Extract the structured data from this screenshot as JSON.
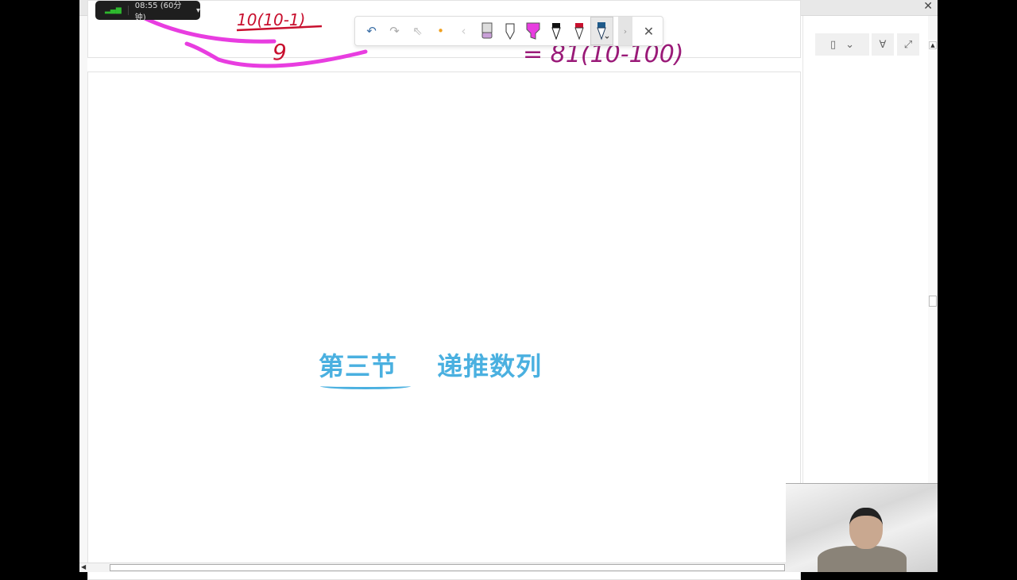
{
  "window": {
    "menu_dots": "···",
    "close": "✕"
  },
  "timer": {
    "label": "08:55 (60分钟)",
    "dropdown": "▾"
  },
  "toolbar": {
    "tools": [
      {
        "name": "undo",
        "glyph": "↶"
      },
      {
        "name": "redo",
        "glyph": "↷"
      },
      {
        "name": "select",
        "glyph": "⇖"
      },
      {
        "name": "laser-dot",
        "glyph": "•"
      },
      {
        "name": "prev",
        "glyph": "‹"
      },
      {
        "name": "eraser",
        "glyph": ""
      },
      {
        "name": "pen-outline",
        "glyph": ""
      },
      {
        "name": "highlighter-magenta",
        "glyph": ""
      },
      {
        "name": "pen-black",
        "glyph": ""
      },
      {
        "name": "pen-red",
        "glyph": ""
      },
      {
        "name": "pen-blue",
        "glyph": ""
      }
    ],
    "next": "›",
    "close": "✕"
  },
  "colors": {
    "accent": "#4ab0e0",
    "magenta": "#e83de0",
    "red_ink": "#c8102e",
    "purple_ink": "#9a1a78"
  },
  "ink": {
    "fraction_num": "10(10-1)",
    "fraction_den": "9",
    "expr": "= 81(10-100)"
  },
  "slide": {
    "section": "第三节",
    "title": "递推数列"
  },
  "right_panel": {
    "layout": "▯",
    "chevron": "⌄",
    "pen": "∀",
    "expand": "⤢"
  },
  "scroll": {
    "up": "▲",
    "left": "◀"
  }
}
